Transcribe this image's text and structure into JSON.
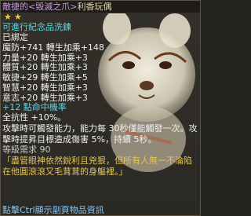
{
  "colors": {
    "title_purple": "#c79bdc",
    "title_bracket": "#b77fd0",
    "owner_name": "#e6d7a8",
    "white": "#f0f0f0",
    "cyan": "#5fd6e6",
    "green": "#6bd46b",
    "grey": "#c8c8c8",
    "orange": "#e89a3c",
    "lore": "#e4c35a",
    "hint": "#8ac4f0"
  },
  "item": {
    "title_prefix": "敵捷的<毀滅之爪>",
    "title_owner": "利香玩偶",
    "stars": "★★",
    "memorial_wash": "可進行紀念品洗鍊",
    "bound": "已綁定"
  },
  "stats": [
    {
      "label": "魔防",
      "value": "+741",
      "bonus": "轉生加乘+148"
    },
    {
      "label": "力量",
      "value": "+20",
      "bonus": "轉生加乘+3"
    },
    {
      "label": "體質",
      "value": "+20",
      "bonus": "轉生加乘+3"
    },
    {
      "label": "敏捷",
      "value": "+29",
      "bonus": "轉生加乘+5"
    },
    {
      "label": "智慧",
      "value": "+20",
      "bonus": "轉生加乘+3"
    },
    {
      "label": "意志",
      "value": "+20",
      "bonus": "轉生加乘+3"
    }
  ],
  "extra_effect": "+12 點命中機率",
  "resist": "全抗性 +10%。",
  "skill_effect": "攻擊時可觸發能力，能力每 30秒僅能觸發一次。攻擊時提昇目標造成傷害 5%，持續 5秒。",
  "level_req": "等級需求 90",
  "lore": "盡管眼神依然銳利且兇狠，但所有人無一不淪陷在他圓滾滾又毛茸茸的身軀裡。",
  "lore_open": "「",
  "lore_close": "」",
  "hint": "點擊Ctrl顯示副頁物品資訊"
}
